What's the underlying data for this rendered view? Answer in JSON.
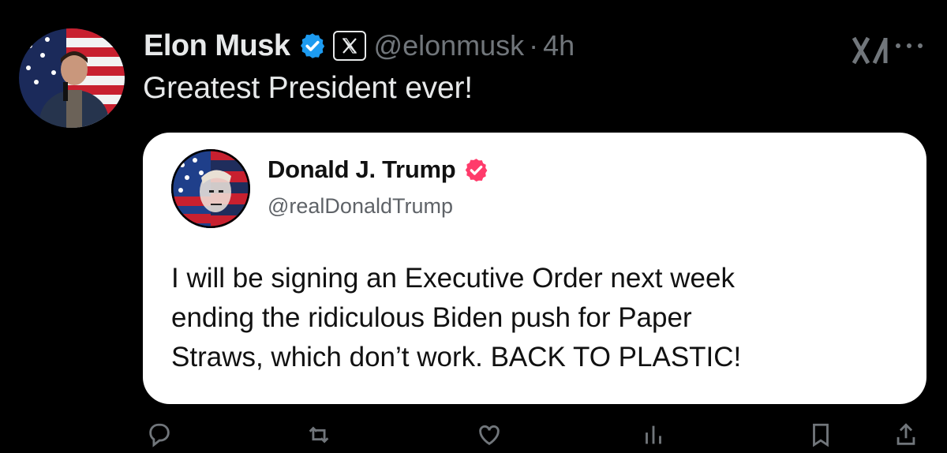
{
  "tweet": {
    "author_name": "Elon Musk",
    "handle": "@elonmusk",
    "separator": "·",
    "time": "4h",
    "text": "Greatest President ever!",
    "affiliation_badge": "X",
    "verified_color": "#1d9bf0"
  },
  "quote": {
    "author_name": "Donald J. Trump",
    "handle": "@realDonaldTrump",
    "verified_color": "#ff3b6b",
    "lines": [
      "I will be signing an Executive Order next week",
      "ending the ridiculous Biden push for Paper",
      "Straws, which don’t work. BACK TO PLASTIC!"
    ]
  },
  "icons": {
    "grok": "grok-icon",
    "more": "more-icon",
    "reply": "reply-icon",
    "repost": "repost-icon",
    "like": "like-icon",
    "views": "views-icon",
    "bookmark": "bookmark-icon",
    "share": "share-icon"
  },
  "colors": {
    "background": "#000000",
    "text": "#e7e9ea",
    "muted": "#71767b",
    "card": "#ffffff"
  }
}
